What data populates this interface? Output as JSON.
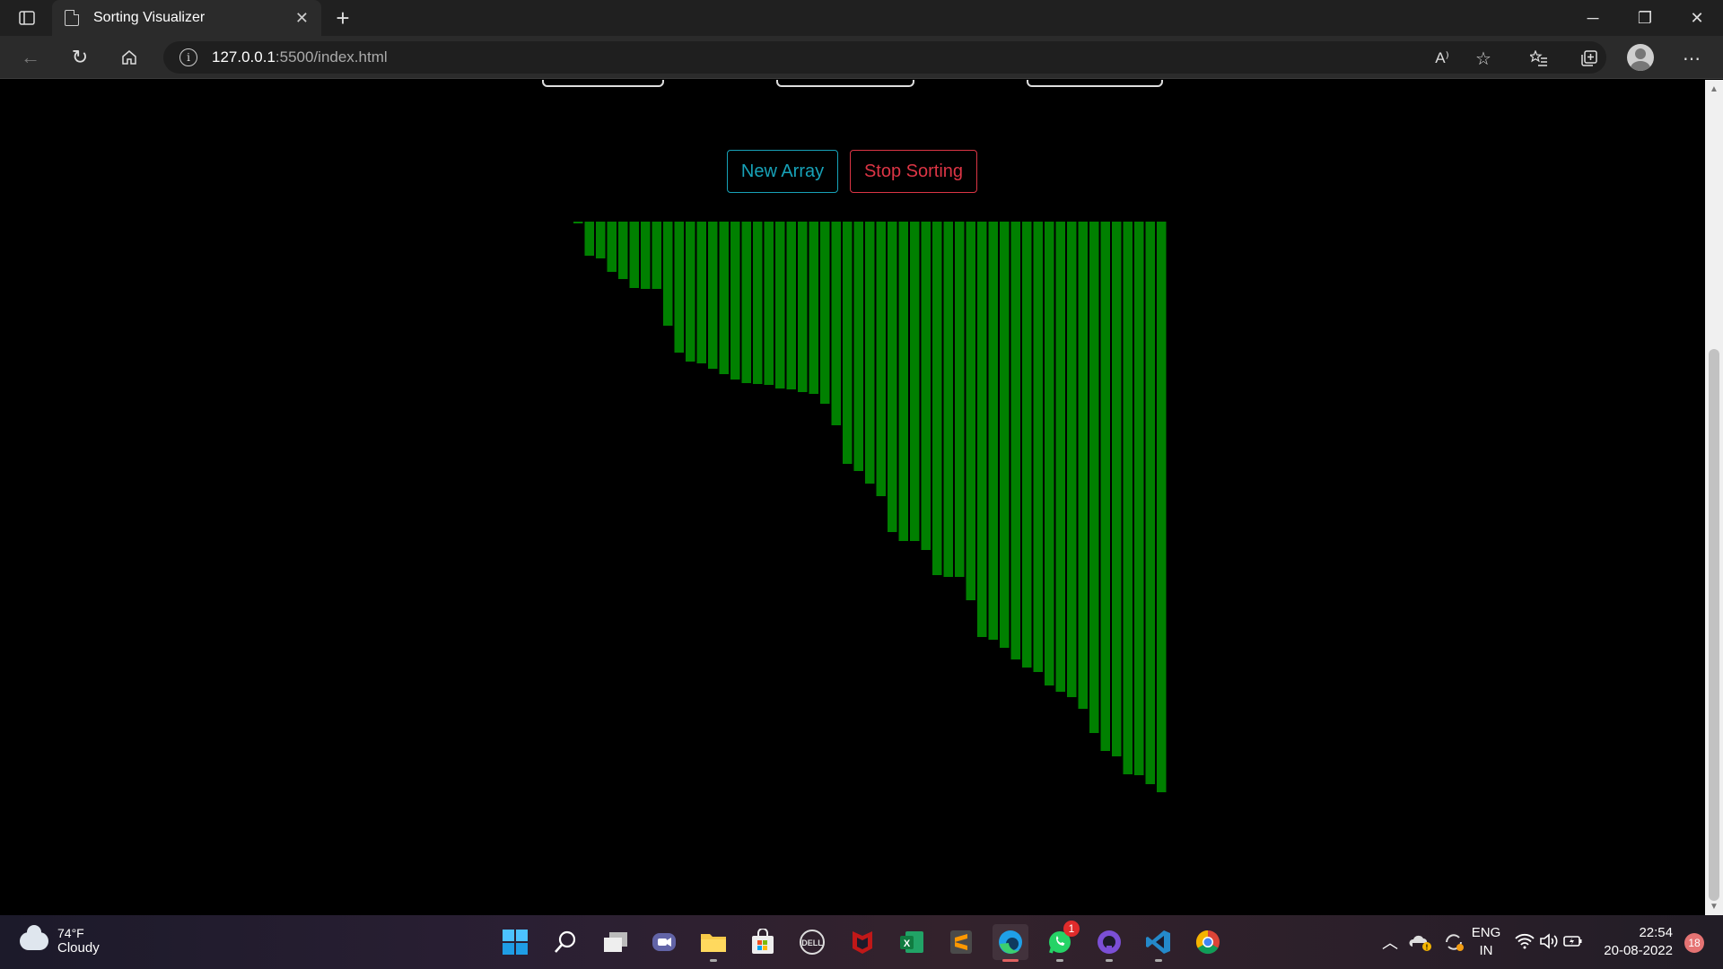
{
  "browser": {
    "tab": {
      "title": "Sorting Visualizer"
    },
    "address": {
      "host": "127.0.0.1",
      "path": ":5500/index.html"
    }
  },
  "page": {
    "buttons": {
      "new_array": "New Array",
      "stop_sorting": "Stop Sorting"
    },
    "bar_color": "#008000",
    "bar_values": [
      2,
      38,
      41,
      56,
      64,
      74,
      75,
      75,
      116,
      146,
      156,
      158,
      164,
      170,
      176,
      180,
      181,
      182,
      186,
      187,
      190,
      192,
      203,
      227,
      270,
      278,
      292,
      306,
      346,
      356,
      356,
      366,
      394,
      396,
      396,
      422,
      463,
      466,
      475,
      488,
      497,
      502,
      517,
      524,
      530,
      543,
      570,
      590,
      596,
      616,
      617,
      627,
      636
    ]
  },
  "taskbar": {
    "weather": {
      "temp": "74°F",
      "condition": "Cloudy"
    },
    "whatsapp_badge": "1",
    "language": {
      "lang": "ENG",
      "region": "IN"
    },
    "clock": {
      "time": "22:54",
      "date": "20-08-2022"
    },
    "notifications": "18"
  }
}
